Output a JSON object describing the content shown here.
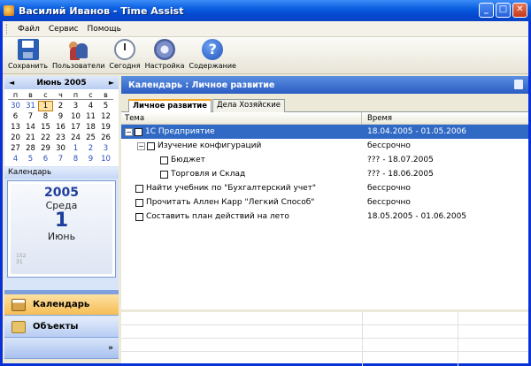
{
  "window": {
    "title": "Василий Иванов - Time Assist"
  },
  "menu": {
    "items": [
      "Файл",
      "Сервис",
      "Помощь"
    ]
  },
  "toolbar": {
    "save": "Сохранить",
    "users": "Пользователи",
    "today": "Сегодня",
    "settings": "Настройка",
    "help": "Содержание"
  },
  "calendar": {
    "month": "Июнь 2005",
    "dow": [
      "п",
      "в",
      "с",
      "ч",
      "п",
      "с",
      "в"
    ],
    "weeks": [
      [
        "30",
        "31",
        "1",
        "2",
        "3",
        "4",
        "5"
      ],
      [
        "6",
        "7",
        "8",
        "9",
        "10",
        "11",
        "12"
      ],
      [
        "13",
        "14",
        "15",
        "16",
        "17",
        "18",
        "19"
      ],
      [
        "20",
        "21",
        "22",
        "23",
        "24",
        "25",
        "26"
      ],
      [
        "27",
        "28",
        "29",
        "30",
        "1",
        "2",
        "3"
      ],
      [
        "4",
        "5",
        "6",
        "7",
        "8",
        "9",
        "10"
      ]
    ],
    "section_label": "Календарь"
  },
  "date_card": {
    "year": "2005",
    "weekday": "Среда",
    "day": "1",
    "month": "Июнь",
    "note_line1": "152",
    "note_line2": "31"
  },
  "nav": {
    "calendar": "Календарь",
    "objects": "Объекты",
    "more": "»"
  },
  "content": {
    "header": "Календарь : Личное развитие",
    "tabs": [
      "Личное развитие",
      "Дела Хозяйские"
    ],
    "columns": {
      "topic": "Тема",
      "time": "Время"
    },
    "rows": [
      {
        "topic": "1С Предприятие",
        "time": "18.04.2005 - 01.05.2006"
      },
      {
        "topic": "Изучение конфигураций",
        "time": "бессрочно"
      },
      {
        "topic": "Бюджет",
        "time": "??? - 18.07.2005"
      },
      {
        "topic": "Торговля и Склад",
        "time": "??? - 18.06.2005"
      },
      {
        "topic": "Найти учебник по \"Бухгалтерский учет\"",
        "time": "бессрочно"
      },
      {
        "topic": "Прочитать Аллен Карр \"Легкий Способ\"",
        "time": "бессрочно"
      },
      {
        "topic": "Составить план действий на лето",
        "time": "18.05.2005 - 01.06.2005"
      }
    ]
  }
}
